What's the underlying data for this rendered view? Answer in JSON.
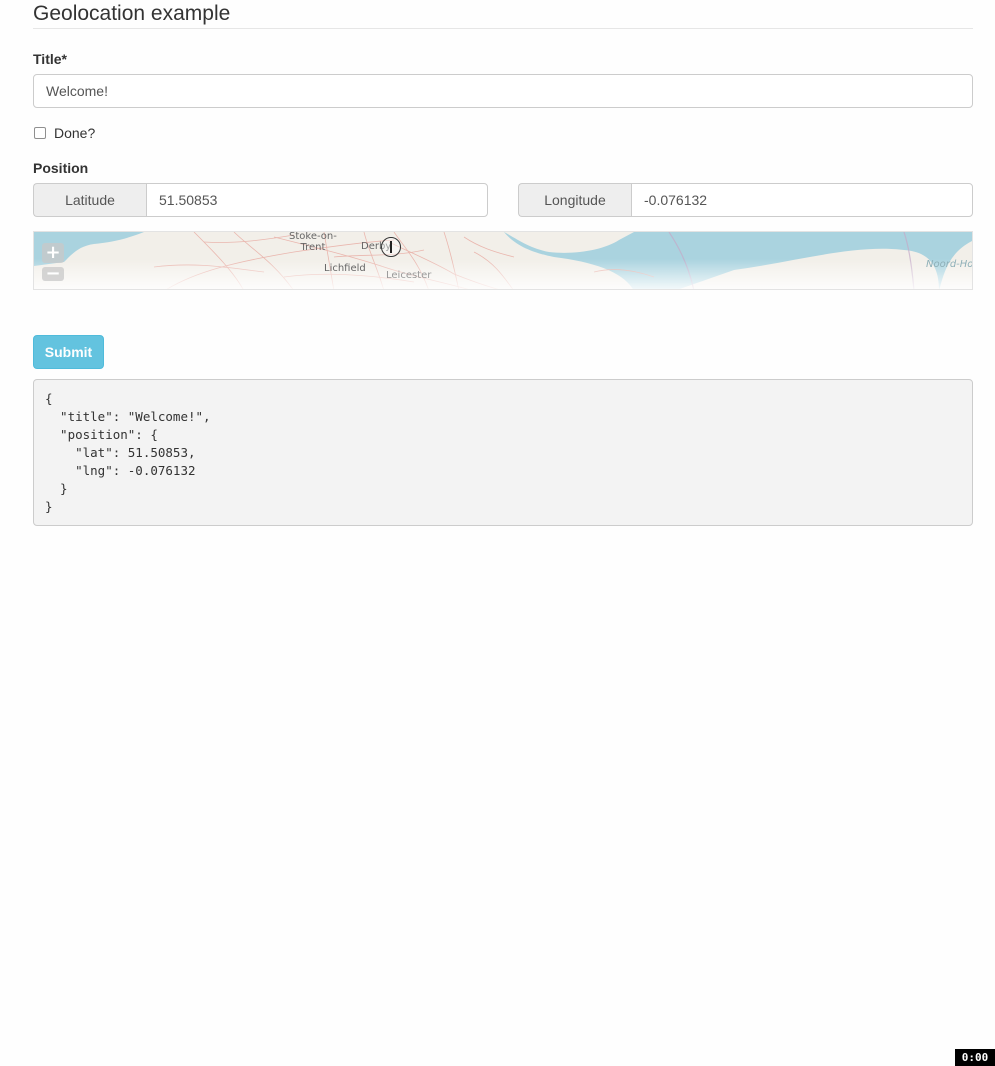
{
  "header": {
    "title": "Geolocation example"
  },
  "form": {
    "title_field": {
      "label": "Title*",
      "value": "Welcome!"
    },
    "done_checkbox": {
      "label": "Done?",
      "checked": false
    },
    "position": {
      "label": "Position",
      "latitude": {
        "addon": "Latitude",
        "value": "51.50853"
      },
      "longitude": {
        "addon": "Longitude",
        "value": "-0.076132"
      }
    },
    "submit_label": "Submit"
  },
  "map": {
    "zoom_in": "+",
    "zoom_out": "−",
    "places": {
      "stoke": "Stoke-on-\nTrent",
      "derby": "Derby",
      "lichfield": "Lichfield",
      "leicester": "Leicester",
      "noord": "Noord-Ho"
    },
    "colors": {
      "land": "#f2efe9",
      "water": "#aad3df",
      "roads": "#e8a9a0"
    }
  },
  "output": {
    "json_text": "{\n  \"title\": \"Welcome!\",\n  \"position\": {\n    \"lat\": 51.50853,\n    \"lng\": -0.076132\n  }\n}"
  },
  "recorder": {
    "timer": "0:00"
  },
  "theme": {
    "accent": "#5bc0de",
    "border": "#cccccc",
    "addon_bg": "#eeeeee"
  }
}
